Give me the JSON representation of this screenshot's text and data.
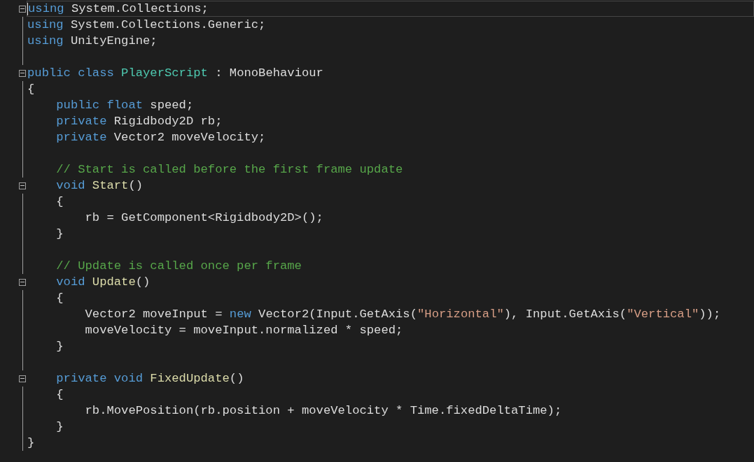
{
  "editor": {
    "lines": [
      {
        "current": true,
        "expanded": true,
        "tokens": [
          {
            "kind": "keyword",
            "text": "using"
          },
          {
            "kind": "plain",
            "text": " System.Collections;"
          }
        ]
      },
      {
        "current": false,
        "tokens": [
          {
            "kind": "keyword",
            "text": "using"
          },
          {
            "kind": "plain",
            "text": " System.Collections.Generic;"
          }
        ]
      },
      {
        "current": false,
        "tokens": [
          {
            "kind": "keyword",
            "text": "using"
          },
          {
            "kind": "plain",
            "text": " UnityEngine;"
          }
        ]
      },
      {
        "current": false
      },
      {
        "current": false,
        "expanded": true,
        "tokens": [
          {
            "kind": "keyword",
            "text": "public class "
          },
          {
            "kind": "type",
            "text": "PlayerScript"
          },
          {
            "kind": "plain",
            "text": " : MonoBehaviour"
          }
        ]
      },
      {
        "current": false,
        "tokens": [
          {
            "kind": "plain",
            "text": "{"
          }
        ]
      },
      {
        "current": false,
        "tokens": [
          {
            "kind": "keyword",
            "text": "    public float"
          },
          {
            "kind": "plain",
            "text": " speed;"
          }
        ]
      },
      {
        "current": false,
        "tokens": [
          {
            "kind": "keyword",
            "text": "    private"
          },
          {
            "kind": "plain",
            "text": " Rigidbody2D rb;"
          }
        ]
      },
      {
        "current": false,
        "tokens": [
          {
            "kind": "keyword",
            "text": "    private"
          },
          {
            "kind": "plain",
            "text": " Vector2 moveVelocity;"
          }
        ]
      },
      {
        "current": false
      },
      {
        "current": false,
        "tokens": [
          {
            "kind": "comment",
            "text": "    // Start is called before the first frame update"
          }
        ]
      },
      {
        "current": false,
        "expanded": true,
        "tokens": [
          {
            "kind": "keyword",
            "text": "    void "
          },
          {
            "kind": "method",
            "text": "Start"
          },
          {
            "kind": "plain",
            "text": "()"
          }
        ]
      },
      {
        "current": false,
        "tokens": [
          {
            "kind": "plain",
            "text": "    {"
          }
        ]
      },
      {
        "current": false,
        "tokens": [
          {
            "kind": "plain",
            "text": "        rb = GetComponent<Rigidbody2D>();"
          }
        ]
      },
      {
        "current": false,
        "tokens": [
          {
            "kind": "plain",
            "text": "    }"
          }
        ]
      },
      {
        "current": false
      },
      {
        "current": false,
        "tokens": [
          {
            "kind": "comment",
            "text": "    // Update is called once per frame"
          }
        ]
      },
      {
        "current": false,
        "expanded": true,
        "tokens": [
          {
            "kind": "keyword",
            "text": "    void "
          },
          {
            "kind": "method",
            "text": "Update"
          },
          {
            "kind": "plain",
            "text": "()"
          }
        ]
      },
      {
        "current": false,
        "tokens": [
          {
            "kind": "plain",
            "text": "    {"
          }
        ]
      },
      {
        "current": false,
        "tokens": [
          {
            "kind": "plain",
            "text": "        Vector2 moveInput = "
          },
          {
            "kind": "keyword",
            "text": "new"
          },
          {
            "kind": "plain",
            "text": " Vector2(Input.GetAxis("
          },
          {
            "kind": "string",
            "text": "\"Horizontal\""
          },
          {
            "kind": "plain",
            "text": "), Input.GetAxis("
          },
          {
            "kind": "string",
            "text": "\"Vertical\""
          },
          {
            "kind": "plain",
            "text": "));"
          }
        ]
      },
      {
        "current": false,
        "tokens": [
          {
            "kind": "plain",
            "text": "        moveVelocity = moveInput.normalized * speed;"
          }
        ]
      },
      {
        "current": false,
        "tokens": [
          {
            "kind": "plain",
            "text": "    }"
          }
        ]
      },
      {
        "current": false
      },
      {
        "current": false,
        "expanded": true,
        "tokens": [
          {
            "kind": "keyword",
            "text": "    private void "
          },
          {
            "kind": "method",
            "text": "FixedUpdate"
          },
          {
            "kind": "plain",
            "text": "()"
          }
        ]
      },
      {
        "current": false,
        "tokens": [
          {
            "kind": "plain",
            "text": "    {"
          }
        ]
      },
      {
        "current": false,
        "tokens": [
          {
            "kind": "plain",
            "text": "        rb.MovePosition(rb.position + moveVelocity * Time.fixedDeltaTime);"
          }
        ]
      },
      {
        "current": false,
        "tokens": [
          {
            "kind": "plain",
            "text": "    }"
          }
        ]
      },
      {
        "current": false,
        "tokens": [
          {
            "kind": "plain",
            "text": "}"
          }
        ]
      }
    ]
  }
}
